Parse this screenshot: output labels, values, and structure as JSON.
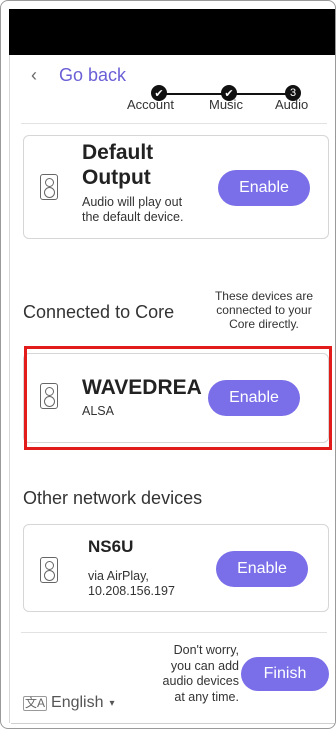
{
  "header": {
    "back_label": "Go back",
    "steps": [
      {
        "label": "Account",
        "state": "done",
        "glyph": "✔"
      },
      {
        "label": "Music",
        "state": "done",
        "glyph": "✔"
      },
      {
        "label": "Audio",
        "state": "current",
        "glyph": "3"
      }
    ]
  },
  "default_output": {
    "title_line1": "Default",
    "title_line2": "Output",
    "desc_line1": "Audio will play out",
    "desc_line2": "the default device.",
    "button": "Enable",
    "icon": "speaker-icon"
  },
  "core_section": {
    "title": "Connected to Core",
    "note_line1": "These devices are",
    "note_line2": "connected to your",
    "note_line3": "Core directly.",
    "device": {
      "name": "WAVEDREA",
      "subtitle": "ALSA",
      "button": "Enable",
      "icon": "speaker-icon"
    }
  },
  "network_section": {
    "title": "Other network devices",
    "device": {
      "name": "NS6U",
      "subtitle_line1": "via AirPlay,",
      "subtitle_line2": "10.208.156.197",
      "button": "Enable",
      "icon": "speaker-icon"
    }
  },
  "footer": {
    "note_line1": "Don't worry,",
    "note_line2": "you can add",
    "note_line3": "audio devices",
    "note_line4": "at any time.",
    "finish": "Finish",
    "language": "English",
    "language_icon": "translate-icon",
    "language_caret": "▾"
  },
  "colors": {
    "accent": "#7a6fe8",
    "highlight": "#e21b1b",
    "link": "#6a5fd6"
  }
}
